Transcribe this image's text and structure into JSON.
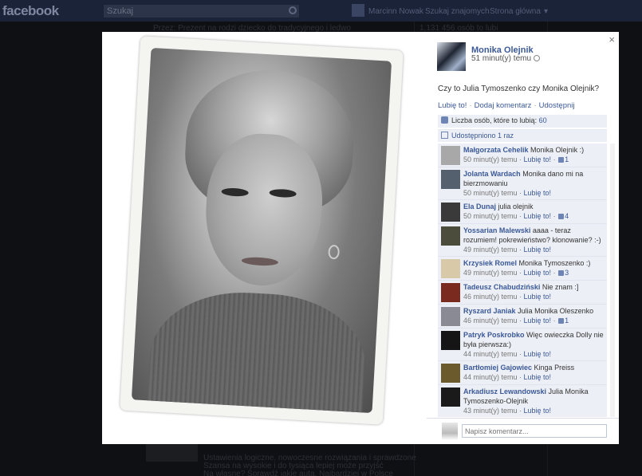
{
  "background": {
    "logo": "facebook",
    "search_placeholder": "Szukaj",
    "nav": [
      "Marcinn Nowak",
      "Szukaj znajomych",
      "Strona główna"
    ],
    "bg_lines": [
      "Przez: Prezent na rodzi dziecko do tradycyjnego i ledwo",
      "1,131 456 osób to lubi",
      "Ustawienia logiczne, nowoczesne rozwiązania i sprawdzone",
      "Szansa na wysokie i do tysiąca lepiej może przyjść",
      "Na własne? Sprawdź jakie auta, Najbardziej w Polsce"
    ]
  },
  "post": {
    "author": "Monika Olejnik",
    "time": "51 minut(y) temu",
    "caption": "Czy to Julia Tymoszenko czy Monika Olejnik?",
    "actions": [
      "Lubię to!",
      "Dodaj komentarz",
      "Udostępnij"
    ],
    "likes_label": "Liczba osób, które to lubią:",
    "likes_count": "60",
    "shares": "Udostępniono 1 raz",
    "close": "×"
  },
  "comments": [
    {
      "name": "Małgorzata Cehelik",
      "text": "Monika Olejnik :)",
      "time": "50 minut(y) temu",
      "like": "Lubię to!",
      "count": "1",
      "avatar": "#a8a8a8"
    },
    {
      "name": "Jolanta Wardach",
      "text": "Monika dano mi na bierzmowaniu",
      "time": "50 minut(y) temu",
      "like": "Lubię to!",
      "count": "",
      "avatar": "#55606e"
    },
    {
      "name": "Ela Dunaj",
      "text": "julia olejnik",
      "time": "50 minut(y) temu",
      "like": "Lubię to!",
      "count": "4",
      "avatar": "#3a3a3a"
    },
    {
      "name": "Yossarian Malewski",
      "text": "aaaa - teraz rozumiem! pokrewieństwo? klonowanie? :-)",
      "time": "49 minut(y) temu",
      "like": "Lubię to!",
      "count": "",
      "avatar": "#4c4c3c"
    },
    {
      "name": "Krzysiek Romel",
      "text": "Monika Tymoszenko :)",
      "time": "49 minut(y) temu",
      "like": "Lubię to!",
      "count": "3",
      "avatar": "#d8c9a8"
    },
    {
      "name": "Tadeusz Chabudziński",
      "text": "Nie znam :]",
      "time": "46 minut(y) temu",
      "like": "Lubię to!",
      "count": "",
      "avatar": "#7a2a1e"
    },
    {
      "name": "Ryszard Janiak",
      "text": "Julia Monika Oleszenko",
      "time": "46 minut(y) temu",
      "like": "Lubię to!",
      "count": "1",
      "avatar": "#8a8a95"
    },
    {
      "name": "Patryk Poskrobko",
      "text": "Więc owieczka Dolly nie była pierwsza:)",
      "time": "44 minut(y) temu",
      "like": "Lubię to!",
      "count": "",
      "avatar": "#151515"
    },
    {
      "name": "Bartłomiej Gajowiec",
      "text": "Kinga Preiss",
      "time": "44 minut(y) temu",
      "like": "Lubię to!",
      "count": "",
      "avatar": "#6b5a2c"
    },
    {
      "name": "Arkadiusz Lewandowski",
      "text": "Julia Monika Tymoszenko-Olejnik",
      "time": "43 minut(y) temu",
      "like": "Lubię to!",
      "count": "",
      "avatar": "#1a1a1a"
    }
  ],
  "composer": {
    "placeholder": "Napisz komentarz..."
  }
}
